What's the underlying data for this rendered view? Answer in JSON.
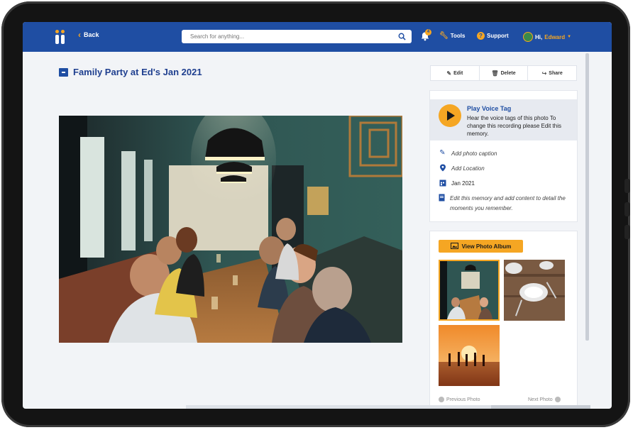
{
  "nav": {
    "back_label": "Back",
    "search_placeholder": "Search for anything...",
    "notification_count": "4",
    "tools_label": "Tools",
    "support_label": "Support",
    "greeting": "Hi,",
    "user_name": "Edward"
  },
  "memory": {
    "title": "Family Party at Ed's Jan 2021"
  },
  "actions": {
    "edit_label": "Edit",
    "delete_label": "Delete",
    "share_label": "Share"
  },
  "voice_tag": {
    "title": "Play Voice Tag",
    "description": "Hear the voice tags of this photo To change this recording please Edit this memory."
  },
  "details": {
    "caption_prompt": "Add photo caption",
    "location_prompt": "Add Location",
    "date": "Jan 2021",
    "edit_hint": "Edit this memory and add content to detail the moments you remember."
  },
  "album": {
    "button_label": "View Photo Album",
    "thumbnails": [
      "restaurant-party",
      "table-setting",
      "sunset-beach"
    ],
    "selected_index": 0,
    "prev_label": "Previous Photo",
    "next_label": "Next Photo"
  },
  "colors": {
    "brand_blue": "#1f4ea3",
    "accent_orange": "#f5a623",
    "background": "#f2f4f7"
  }
}
